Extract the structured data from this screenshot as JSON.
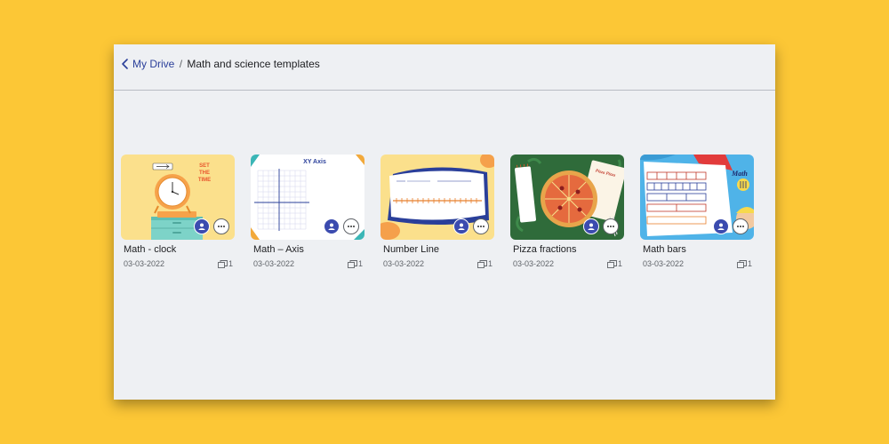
{
  "breadcrumb": {
    "root": "My Drive",
    "separator": "/",
    "current": "Math and science templates"
  },
  "files": [
    {
      "title": "Math - clock",
      "date": "03-03-2022",
      "copies": "1",
      "thumb_heading": "SET THE TIME"
    },
    {
      "title": "Math – Axis",
      "date": "03-03-2022",
      "copies": "1",
      "thumb_heading": "XY Axis"
    },
    {
      "title": "Number Line",
      "date": "03-03-2022",
      "copies": "1"
    },
    {
      "title": "Pizza fractions",
      "date": "03-03-2022",
      "copies": "1",
      "thumb_heading": "Pizza Pizza"
    },
    {
      "title": "Math bars",
      "date": "03-03-2022",
      "copies": "1",
      "thumb_heading": "Math"
    }
  ],
  "icons": {
    "back": "chevron-left-icon",
    "avatar": "user-avatar-icon",
    "more": "more-horizontal-icon",
    "copies": "copy-stack-icon"
  },
  "colors": {
    "background": "#FCC736",
    "panel": "#EEF0F3",
    "link": "#2A3F9A",
    "avatar": "#3B4BAF"
  }
}
